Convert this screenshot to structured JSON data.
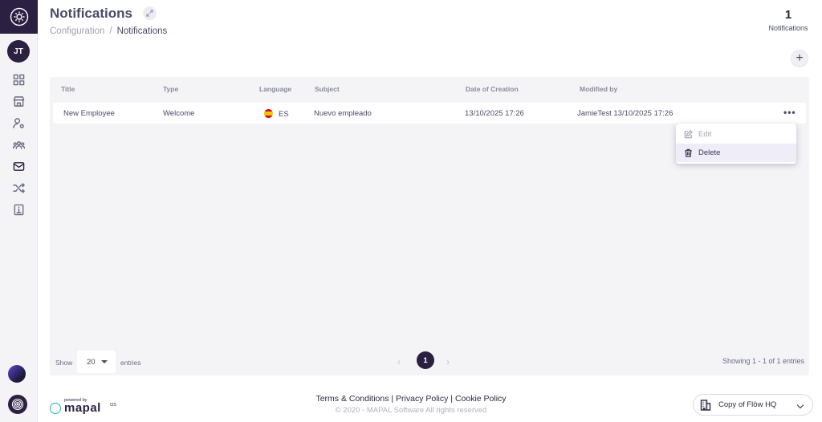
{
  "sidebar": {
    "avatar_initials": "JT",
    "nav": [
      {
        "icon": "grid-icon"
      },
      {
        "icon": "store-icon"
      },
      {
        "icon": "user-settings-icon"
      },
      {
        "icon": "team-icon"
      },
      {
        "icon": "mail-icon",
        "active": true
      },
      {
        "icon": "shuffle-icon"
      },
      {
        "icon": "info-book-icon"
      }
    ]
  },
  "header": {
    "title": "Notifications",
    "breadcrumb": {
      "parent": "Configuration",
      "separator": "/",
      "current": "Notifications"
    },
    "counter": {
      "value": "1",
      "label": "Notifications"
    },
    "add_label": "+"
  },
  "table": {
    "columns": [
      "Title",
      "Type",
      "Language",
      "Subject",
      "Date of Creation",
      "Modified by"
    ],
    "rows": [
      {
        "title": "New Employee",
        "type": "Welcome",
        "language": "ES",
        "subject": "Nuevo empleado",
        "created": "13/10/2025 17:26",
        "modified_by": "JamieTest 13/10/2025 17:26"
      }
    ],
    "row_actions_label": "•••",
    "menu": {
      "edit": "Edit",
      "delete": "Delete"
    },
    "footer": {
      "show_label": "Show",
      "page_size": "20",
      "entries_label": "entries",
      "prev": "‹",
      "current_page": "1",
      "next": "›",
      "showing": "Showing 1 - 1 of 1 entries"
    }
  },
  "footer": {
    "powered_by": "powered by",
    "brand": "mapal",
    "brand_suffix": "OS",
    "links": "Terms & Conditions | Privacy Policy | Cookie Policy",
    "copyright": "© 2020 - MAPAL Software All rights reserved",
    "org": "Copy of Flöw HQ"
  }
}
